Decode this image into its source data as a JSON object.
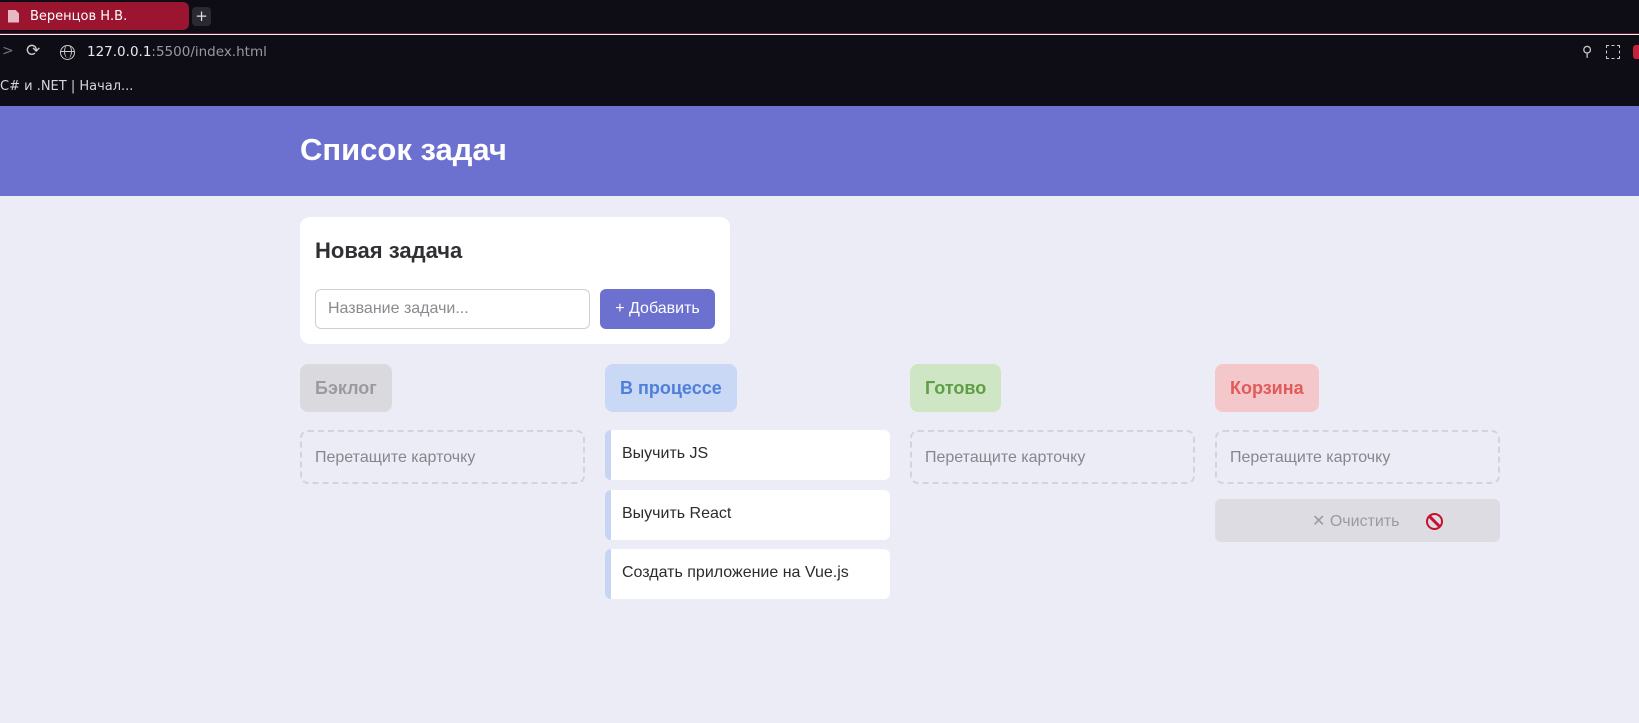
{
  "browser": {
    "tab_title": "Веренцов Н.В.",
    "new_tab_label": "+",
    "url_host": "127.0.0.1",
    "url_path": ":5500/index.html",
    "bookmark": "C# и .NET | Начал..."
  },
  "app": {
    "title": "Список задач",
    "accent_color": "#6c70cf"
  },
  "new_task": {
    "title": "Новая задача",
    "input_placeholder": "Название задачи...",
    "input_value": "",
    "add_button": "+ Добавить"
  },
  "columns": [
    {
      "title": "Бэклог",
      "color": "#9a9aa0",
      "bg": "#d9d9de",
      "placeholder": "Перетащите карточку",
      "cards": []
    },
    {
      "title": "В процессе",
      "color": "#4f7fd9",
      "bg": "#c9d8f5",
      "cards": [
        "Выучить JS",
        "Выучить React",
        "Создать приложение на Vue.js"
      ]
    },
    {
      "title": "Готово",
      "color": "#5e9e45",
      "bg": "#cfe6c4",
      "placeholder": "Перетащите карточку",
      "cards": []
    },
    {
      "title": "Корзина",
      "color": "#e15b5b",
      "bg": "#f4c7cb",
      "placeholder": "Перетащите карточку",
      "cards": [],
      "clear_button": "✕ Очистить"
    }
  ],
  "icons": {
    "tab": "document-icon",
    "reload": "reload-icon",
    "site": "globe-icon",
    "disabled": "no-entry-icon"
  }
}
